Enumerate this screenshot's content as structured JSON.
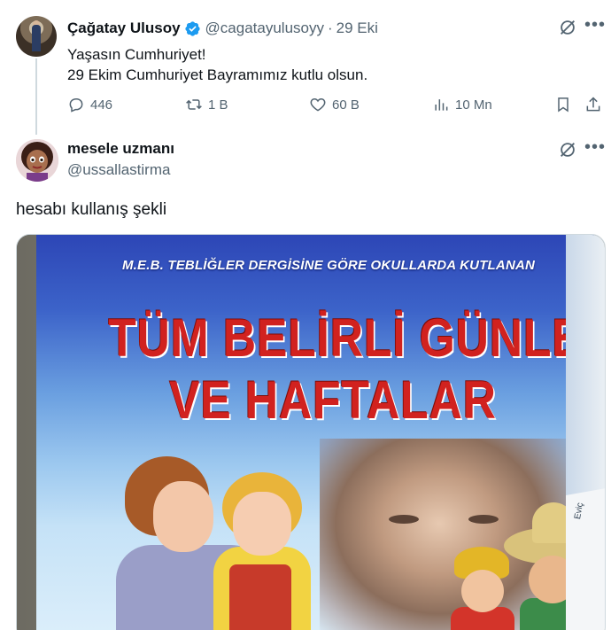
{
  "parent_tweet": {
    "author_name": "Çağatay Ulusoy",
    "author_handle": "@cagatayulusoyy",
    "separator": "·",
    "date": "29 Eki",
    "text_lines": [
      "Yaşasın Cumhuriyet!",
      "29 Ekim Cumhuriyet Bayramımız kutlu olsun."
    ],
    "verified": true,
    "stats": {
      "replies": "446",
      "reposts": "1 B",
      "likes": "60 B",
      "views": "10 Mn"
    }
  },
  "reply_tweet": {
    "author_name": "mesele uzmanı",
    "author_handle": "@ussallastirma",
    "text": "hesabı kullanış şekli"
  },
  "photo": {
    "subtitle": "M.E.B. TEBLİĞLER DERGİSİNE GÖRE OKULLARDA KUTLANAN",
    "title_lines": [
      "TÜM BELİRLİ GÜNLER",
      "VE HAFTALAR"
    ],
    "page_edge_text": "Eviç"
  },
  "colors": {
    "verified": "#1d9bf0",
    "secondary_text": "#536471",
    "title_red": "#d1221f"
  },
  "icons": {
    "top_right": [
      "grok-icon",
      "more-icon"
    ],
    "actions": [
      "reply-icon",
      "retweet-icon",
      "like-icon",
      "views-icon",
      "bookmark-icon",
      "share-icon"
    ]
  }
}
